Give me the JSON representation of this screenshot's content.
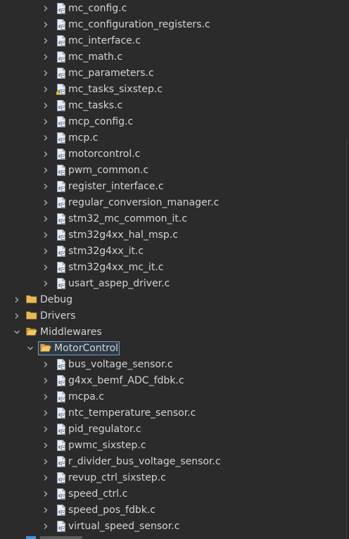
{
  "tree": {
    "core_src_files": [
      {
        "label": "mc_config.c",
        "icon": "c-source-file-icon"
      },
      {
        "label": "mc_configuration_registers.c",
        "icon": "c-source-file-icon"
      },
      {
        "label": "mc_interface.c",
        "icon": "c-source-file-icon"
      },
      {
        "label": "mc_math.c",
        "icon": "c-source-file-icon"
      },
      {
        "label": "mc_parameters.c",
        "icon": "c-source-file-icon"
      },
      {
        "label": "mc_tasks_sixstep.c",
        "icon": "c-source-file-warning-icon"
      },
      {
        "label": "mc_tasks.c",
        "icon": "c-source-file-icon"
      },
      {
        "label": "mcp_config.c",
        "icon": "c-source-file-icon"
      },
      {
        "label": "mcp.c",
        "icon": "c-source-file-icon"
      },
      {
        "label": "motorcontrol.c",
        "icon": "c-source-file-icon"
      },
      {
        "label": "pwm_common.c",
        "icon": "c-source-file-icon"
      },
      {
        "label": "register_interface.c",
        "icon": "c-source-file-icon"
      },
      {
        "label": "regular_conversion_manager.c",
        "icon": "c-source-file-icon"
      },
      {
        "label": "stm32_mc_common_it.c",
        "icon": "c-source-file-icon"
      },
      {
        "label": "stm32g4xx_hal_msp.c",
        "icon": "c-source-file-icon"
      },
      {
        "label": "stm32g4xx_it.c",
        "icon": "c-source-file-icon"
      },
      {
        "label": "stm32g4xx_mc_it.c",
        "icon": "c-source-file-icon"
      },
      {
        "label": "usart_aspep_driver.c",
        "icon": "c-source-file-icon"
      }
    ],
    "folders": [
      {
        "label": "Debug",
        "expanded": false
      },
      {
        "label": "Drivers",
        "expanded": false
      },
      {
        "label": "Middlewares",
        "expanded": true
      }
    ],
    "selected_folder": {
      "label": "MotorControl",
      "expanded": true
    },
    "motorcontrol_files": [
      {
        "label": "bus_voltage_sensor.c"
      },
      {
        "label": "g4xx_bemf_ADC_fdbk.c"
      },
      {
        "label": "mcpa.c"
      },
      {
        "label": "ntc_temperature_sensor.c"
      },
      {
        "label": "pid_regulator.c"
      },
      {
        "label": "pwmc_sixstep.c"
      },
      {
        "label": "r_divider_bus_voltage_sensor.c"
      },
      {
        "label": "revup_ctrl_sixstep.c"
      },
      {
        "label": "speed_ctrl.c"
      },
      {
        "label": "speed_pos_fdbk.c"
      },
      {
        "label": "virtual_speed_sensor.c"
      }
    ],
    "colors": {
      "background": "#2b2b2b",
      "text": "#d4d4d4",
      "selection_border": "#7a9cc0",
      "folder": "#e8b85a"
    }
  }
}
